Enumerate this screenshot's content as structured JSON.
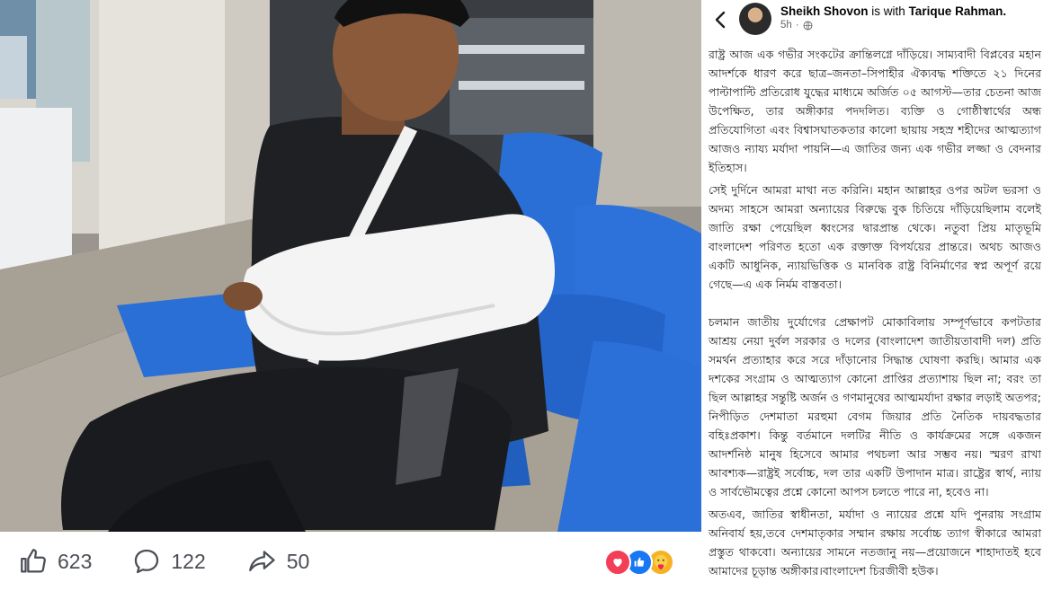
{
  "post": {
    "author": "Sheikh Shovon",
    "with_text": "is with",
    "tagged": "Tarique Rahman.",
    "time": "5h",
    "dot": "·"
  },
  "icons": {
    "back": "chevron-left-icon",
    "like": "thumbs-up-icon",
    "comment": "comment-bubble-icon",
    "share": "share-arrow-icon",
    "globe": "globe-icon",
    "reactions": [
      "love-reaction-icon",
      "like-reaction-icon",
      "care-reaction-icon"
    ]
  },
  "stats": {
    "likes": "623",
    "comments": "122",
    "shares": "50"
  },
  "paragraphs": [
    "রাষ্ট্র আজ এক গভীর সংকটের ক্রান্তিলগ্নে দাঁড়িয়ে। সাম্যবাদী বিপ্লবের মহান আদর্শকে ধারণ করে ছাত্র–জনতা–সিপাহীর ঐক্যবদ্ধ শক্তিতে ২১ দিনের পাল্টাপাল্টি প্রতিরোধ যুদ্ধের মাধ্যমে অর্জিত ০৫ আগস্ট—তার চেতনা আজ উপেক্ষিত, তার অঙ্গীকার পদদলিত। ব্যক্তি ও গোষ্ঠীস্বার্থের অন্ধ প্রতিযোগিতা এবং বিশ্বাসঘাতকতার কালো ছায়ায় সহস্র শহীদের আত্মত্যাগ আজও ন্যায্য মর্যাদা পায়নি—এ জাতির জন্য এক গভীর লজ্জা ও বেদনার ইতিহাস।",
    "সেই দুর্দিনে আমরা মাথা নত করিনি। মহান আল্লাহর ওপর অটল ভরসা ও অদম্য সাহসে আমরা অন্যায়ের বিরুদ্ধে বুক চিতিয়ে দাঁড়িয়েছিলাম বলেই জাতি রক্ষা পেয়েছিল ধ্বংসের দ্বারপ্রান্ত থেকে। নতুবা প্রিয় মাতৃভূমি বাংলাদেশ পরিণত হতো এক রক্তাক্ত বিপর্যয়ের প্রান্তরে। অথচ আজও একটি আধুনিক, ন্যায়ভিত্তিক ও মানবিক রাষ্ট্র বিনির্মাণের স্বপ্ন অপূর্ণ রয়ে গেছে—এ এক নির্মম বাস্তবতা।",
    "চলমান জাতীয় দুর্যোগের প্রেক্ষাপট মোকাবিলায় সম্পূর্ণভাবে কপটতার আশ্রয় নেয়া দুর্বল সরকার ও দলের (বাংলাদেশ জাতীয়তাবাদী দল) প্রতি সমর্থন প্রত্যাহার করে সরে দাঁড়ানোর সিদ্ধান্ত ঘোষণা করছি। আমার এক দশকের সংগ্রাম ও আত্মত্যাগ কোনো প্রাপ্তির প্রত্যাশায় ছিল না; বরং তা ছিল আল্লাহর সন্তুষ্টি অর্জন ও গণমানুষের আত্মমর্যাদা রক্ষার লড়াই অতপর; নিপীড়িত দেশমাতা মরহুমা বেগম জিয়ার প্রতি নৈতিক দায়বদ্ধতার বহিঃপ্রকাশ। কিন্তু বর্তমানে দলটির নীতি ও কার্যক্রমের সঙ্গে একজন আদর্শনিষ্ঠ মানুষ হিসেবে আমার পথচলা আর সম্ভব নয়। স্মরণ রাখা আবশ্যক—রাষ্ট্রই সর্বোচ্চ, দল তার একটি উপাদান মাত্র। রাষ্ট্রের স্বার্থ, ন্যায় ও সার্বভৌমত্বের প্রশ্নে কোনো আপস চলতে পারে না, হবেও না।",
    "অতএব, জাতির স্বাধীনতা, মর্যাদা ও ন্যায়ের প্রশ্নে যদি পুনরায় সংগ্রাম অনিবার্য হয়,তবে দেশমাতৃকার সম্মান রক্ষায় সর্বোচ্চ ত্যাগ স্বীকারে আমরা প্রস্তুত থাকবো। অন্যায়ের সামনে নতজানু নয়—প্রয়োজনে শাহাদাতই হবে আমাদের চূড়ান্ত অঙ্গীকার।বাংলাদেশ চিরজীবী হউক।"
  ]
}
